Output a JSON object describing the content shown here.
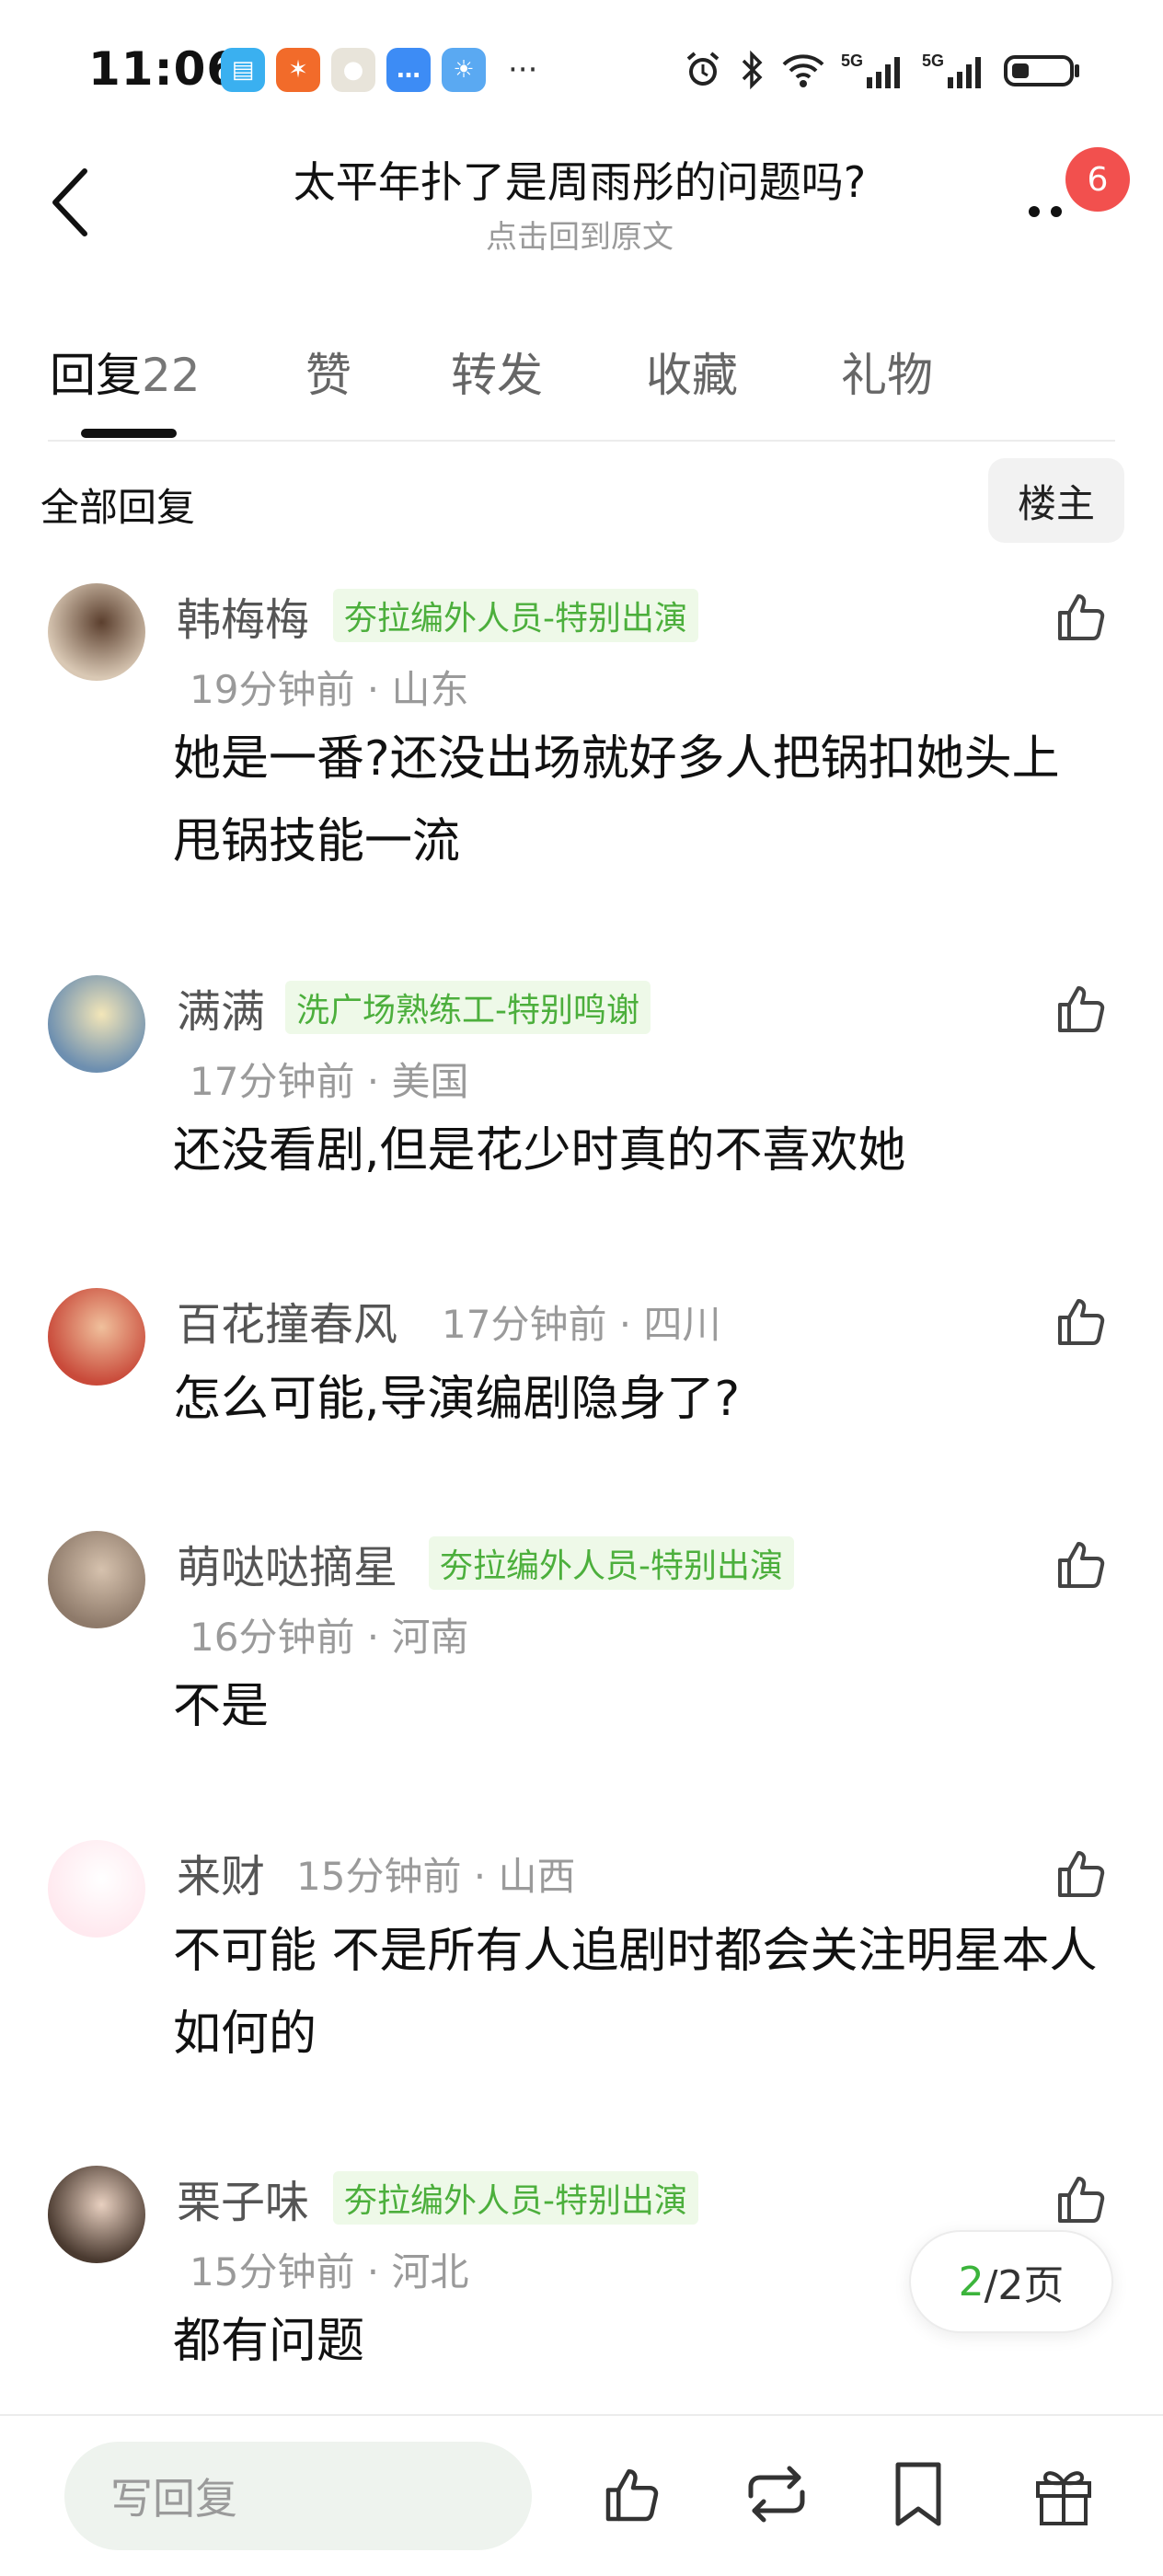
{
  "status_bar": {
    "time": "11:06",
    "app_icons": [
      {
        "name": "book-app-icon",
        "color": "#3ab0f0",
        "glyph": "▤"
      },
      {
        "name": "runner-app-icon",
        "color": "#f26b2a",
        "glyph": "✶"
      },
      {
        "name": "pearl-app-icon",
        "color": "#e8e4da",
        "glyph": "●"
      },
      {
        "name": "message-app-icon",
        "color": "#3d8cf5",
        "glyph": "…"
      },
      {
        "name": "weather-app-icon",
        "color": "#5aa9f2",
        "glyph": "☀"
      }
    ],
    "overflow": "···",
    "network_5g": "5G"
  },
  "nav": {
    "title": "太平年扑了是周雨彤的问题吗?",
    "subtitle": "点击回到原文",
    "badge": "6"
  },
  "tabs": [
    {
      "label": "回复",
      "count": "22",
      "active": true
    },
    {
      "label": "赞",
      "count": "",
      "active": false
    },
    {
      "label": "转发",
      "count": "",
      "active": false
    },
    {
      "label": "收藏",
      "count": "",
      "active": false
    },
    {
      "label": "礼物",
      "count": "",
      "active": false
    }
  ],
  "filter": {
    "label": "全部回复",
    "owner_button": "楼主"
  },
  "comments": [
    {
      "name": "韩梅梅",
      "tag": "夯拉编外人员-特别出演",
      "time": "19分钟前",
      "location": "山东",
      "text": "她是一番?还没出场就好多人把锅扣她头上 甩锅技能一流",
      "avatar_colors": [
        "#d9c8b4",
        "#5b3f2e"
      ]
    },
    {
      "name": "满满",
      "tag": "洗广场熟练工-特别鸣谢",
      "time": "17分钟前",
      "location": "美国",
      "text": "还没看剧,但是花少时真的不喜欢她",
      "avatar_colors": [
        "#6d8fb0",
        "#f3e6b8"
      ]
    },
    {
      "name": "百花撞春风",
      "tag": "",
      "time": "17分钟前",
      "location": "四川",
      "text": "怎么可能,导演编剧隐身了?",
      "avatar_colors": [
        "#c94a3a",
        "#f0c09c"
      ]
    },
    {
      "name": "萌哒哒摘星",
      "tag": "夯拉编外人员-特别出演",
      "time": "16分钟前",
      "location": "河南",
      "text": "不是",
      "avatar_colors": [
        "#8e7a6a",
        "#d6c2ae"
      ]
    },
    {
      "name": "来财",
      "tag": "",
      "time": "15分钟前",
      "location": "山西",
      "text": "不可能 不是所有人追剧时都会关注明星本人如何的",
      "avatar_colors": [
        "#ffe9ef",
        "#ffffff"
      ]
    },
    {
      "name": "栗子味",
      "tag": "夯拉编外人员-特别出演",
      "time": "15分钟前",
      "location": "河北",
      "text": "都有问题",
      "avatar_colors": [
        "#4a3a30",
        "#e8d0c0"
      ]
    }
  ],
  "pager": {
    "current": "2",
    "total": "/2页"
  },
  "bottom_bar": {
    "reply_placeholder": "写回复"
  },
  "accent_color": "#3cb43c",
  "badge_color": "#f2504e"
}
